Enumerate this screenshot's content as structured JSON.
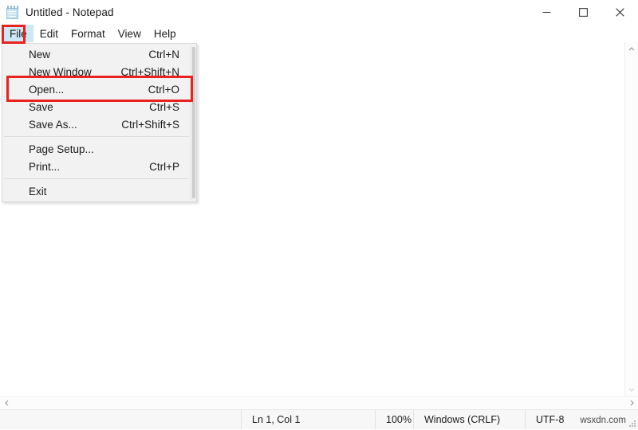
{
  "window": {
    "title": "Untitled - Notepad",
    "icon": "notepad-icon",
    "controls": {
      "minimize": "minimize-icon",
      "maximize": "maximize-icon",
      "close": "close-icon"
    }
  },
  "menubar": {
    "items": [
      {
        "label": "File",
        "active": true
      },
      {
        "label": "Edit",
        "active": false
      },
      {
        "label": "Format",
        "active": false
      },
      {
        "label": "View",
        "active": false
      },
      {
        "label": "Help",
        "active": false
      }
    ]
  },
  "file_menu": {
    "items": [
      {
        "label": "New",
        "accel": "Ctrl+N"
      },
      {
        "label": "New Window",
        "accel": "Ctrl+Shift+N"
      },
      {
        "label": "Open...",
        "accel": "Ctrl+O"
      },
      {
        "label": "Save",
        "accel": "Ctrl+S"
      },
      {
        "label": "Save As...",
        "accel": "Ctrl+Shift+S"
      },
      {
        "label": "Page Setup...",
        "accel": ""
      },
      {
        "label": "Print...",
        "accel": "Ctrl+P"
      },
      {
        "label": "Exit",
        "accel": ""
      }
    ]
  },
  "editor": {
    "value": "",
    "placeholder": ""
  },
  "statusbar": {
    "position": "Ln 1, Col 1",
    "zoom": "100%",
    "line_ending": "Windows (CRLF)",
    "encoding": "UTF-8",
    "watermark": "wsxdn.com"
  },
  "annotations": {
    "highlight_color": "#e8231f",
    "boxes": [
      {
        "name": "file-menu-highlight",
        "target": "File"
      },
      {
        "name": "open-item-highlight",
        "target": "Open..."
      }
    ]
  },
  "colors": {
    "menu_highlight": "#cce8f4",
    "annotation_red": "#e8231f",
    "statusbar_bg": "#f7f7f7",
    "menu_bg": "#f2f2f2"
  }
}
